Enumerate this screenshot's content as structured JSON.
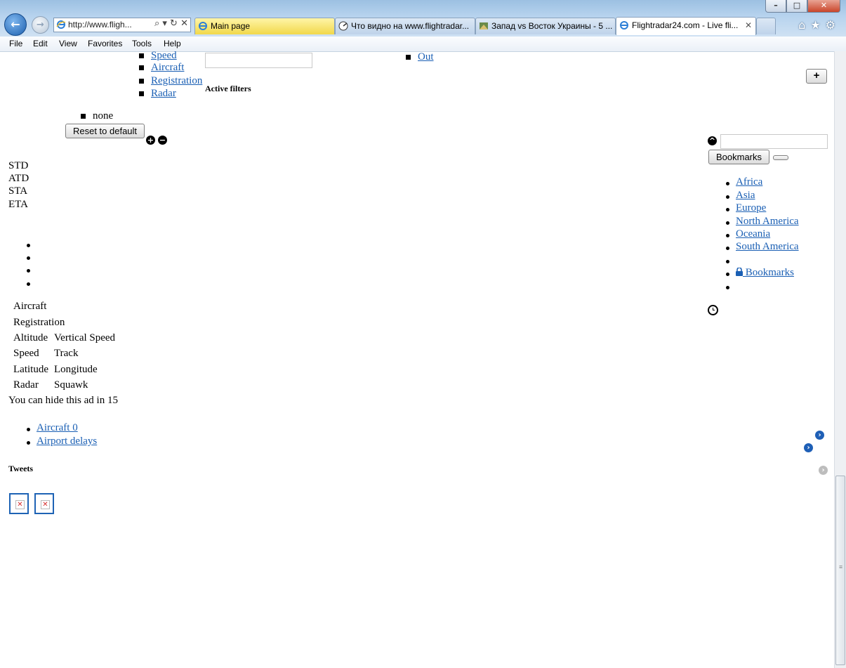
{
  "browser": {
    "address_text": "http://www.fligh...",
    "tabs": [
      {
        "label": "Main page",
        "icon": "ie-page-icon"
      },
      {
        "label": "Что видно на www.flightradar...",
        "icon": "radar-page-icon"
      },
      {
        "label": "Запад vs Восток Украины - 5 ...",
        "icon": "map-page-icon"
      },
      {
        "label": "Flightradar24.com - Live fli...",
        "icon": "ie-page-icon",
        "close": "✕"
      }
    ],
    "menu": [
      "File",
      "Edit",
      "View",
      "Favorites",
      "Tools",
      "Help"
    ]
  },
  "filters": {
    "links": [
      "Speed",
      "Aircraft",
      "Registration",
      "Radar"
    ],
    "active_filters_heading": "Active filters",
    "out_link": "Out",
    "active_items": [
      "none"
    ],
    "reset_button": "Reset to default"
  },
  "times": [
    "STD",
    "ATD",
    "STA",
    "ETA"
  ],
  "flight_info_rows": [
    [
      "Aircraft",
      ""
    ],
    [
      "Registration",
      ""
    ],
    [
      "Altitude",
      "Vertical Speed"
    ],
    [
      "Speed",
      "Track"
    ],
    [
      "Latitude",
      "Longitude"
    ],
    [
      "Radar",
      "Squawk"
    ]
  ],
  "ad_notice": "You can hide this ad in 15",
  "bottom_links": [
    "Aircraft 0",
    "Airport delays"
  ],
  "tweets_heading": "Tweets",
  "bookmarks": {
    "button_label": "Bookmarks",
    "regions": [
      "Africa",
      "Asia",
      "Europe",
      "North America",
      "Oceania",
      "South America"
    ],
    "locked_link": " Bookmarks"
  }
}
